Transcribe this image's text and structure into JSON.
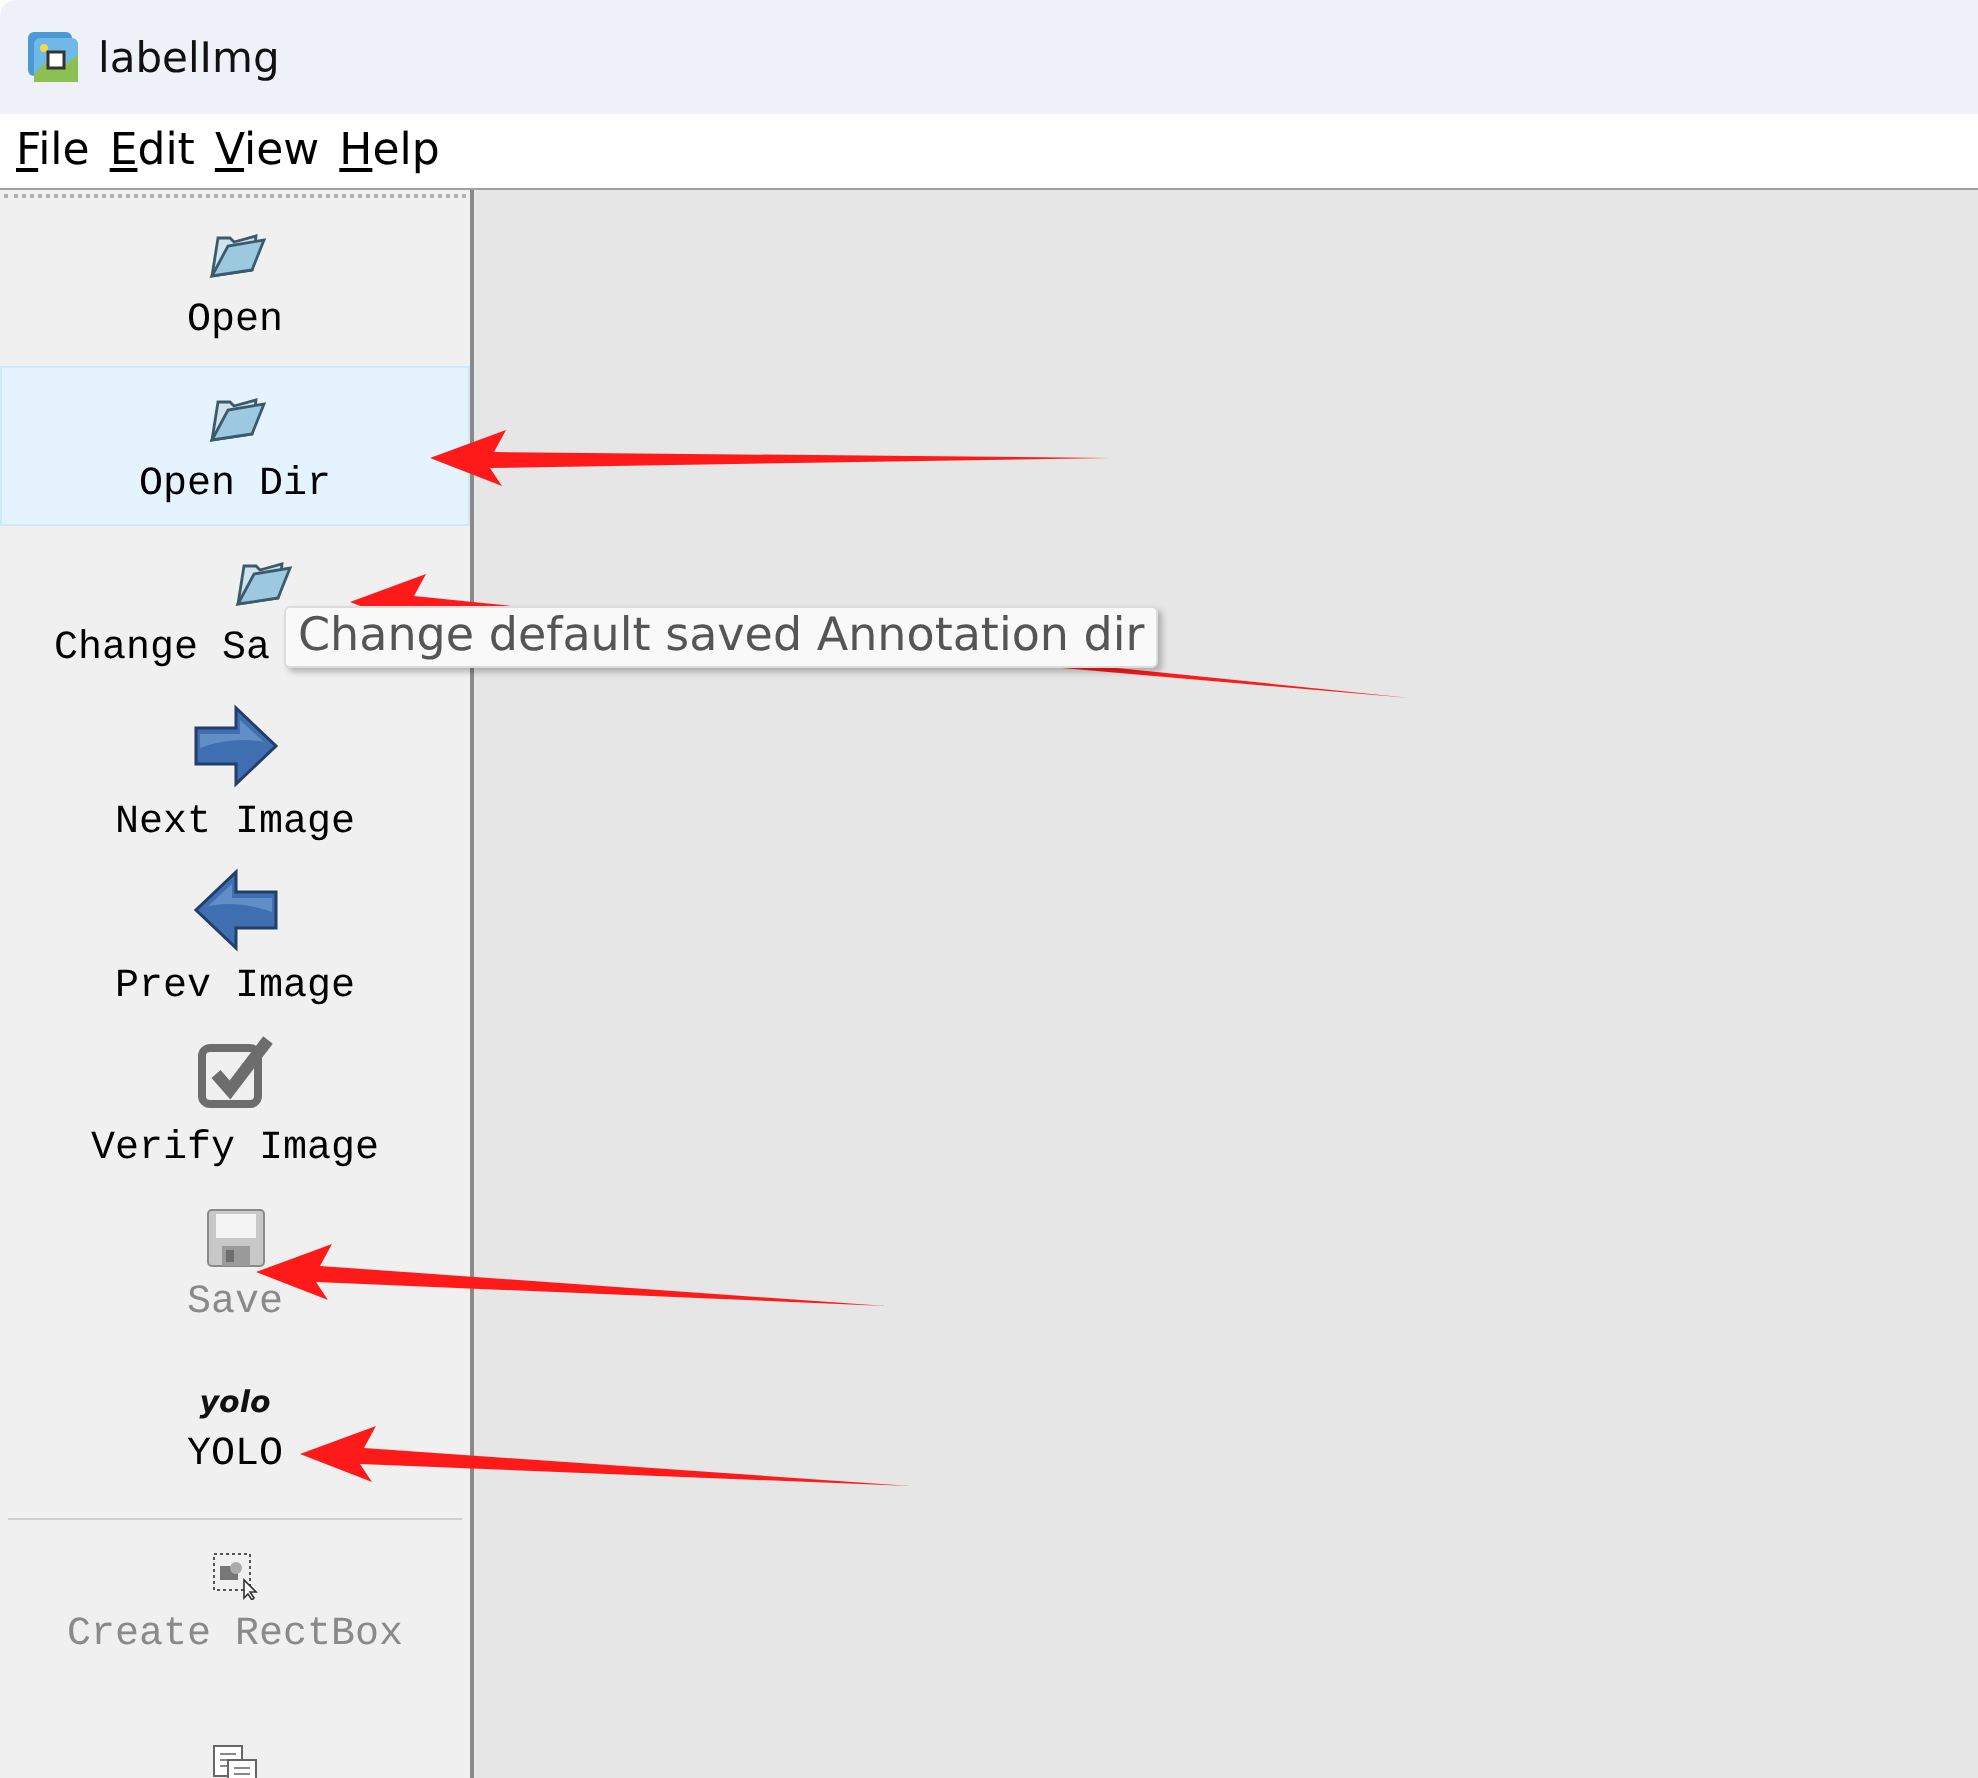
{
  "window": {
    "title": "labelImg"
  },
  "menu": [
    {
      "label": "File"
    },
    {
      "label": "Edit"
    },
    {
      "label": "View"
    },
    {
      "label": "Help"
    }
  ],
  "toolbar": [
    {
      "kind": "folder",
      "label": "Open",
      "disabled": false,
      "selected": false,
      "arrow": false
    },
    {
      "kind": "folder",
      "label": "Open Dir",
      "disabled": false,
      "selected": true,
      "arrow": true
    },
    {
      "kind": "folder",
      "label": "Change Sa",
      "disabled": false,
      "selected": false,
      "arrow": true,
      "tooltip": "Change default saved Annotation dir"
    },
    {
      "kind": "arrow-right",
      "label": "Next Image",
      "disabled": false,
      "selected": false,
      "arrow": false
    },
    {
      "kind": "arrow-left",
      "label": "Prev Image",
      "disabled": false,
      "selected": false,
      "arrow": false
    },
    {
      "kind": "checkbox",
      "label": "Verify Image",
      "disabled": false,
      "selected": false,
      "arrow": false
    },
    {
      "kind": "floppy",
      "label": "Save",
      "disabled": true,
      "selected": false,
      "arrow": true
    },
    {
      "kind": "text",
      "icon_text": "yolo",
      "label": "YOLO",
      "disabled": false,
      "selected": false,
      "arrow": true
    },
    {
      "kind": "rectbox",
      "label": "Create RectBox",
      "disabled": true,
      "selected": false,
      "arrow": false,
      "separator_before": true
    },
    {
      "kind": "copy",
      "disabled": false,
      "selected": false,
      "arrow": false
    }
  ]
}
